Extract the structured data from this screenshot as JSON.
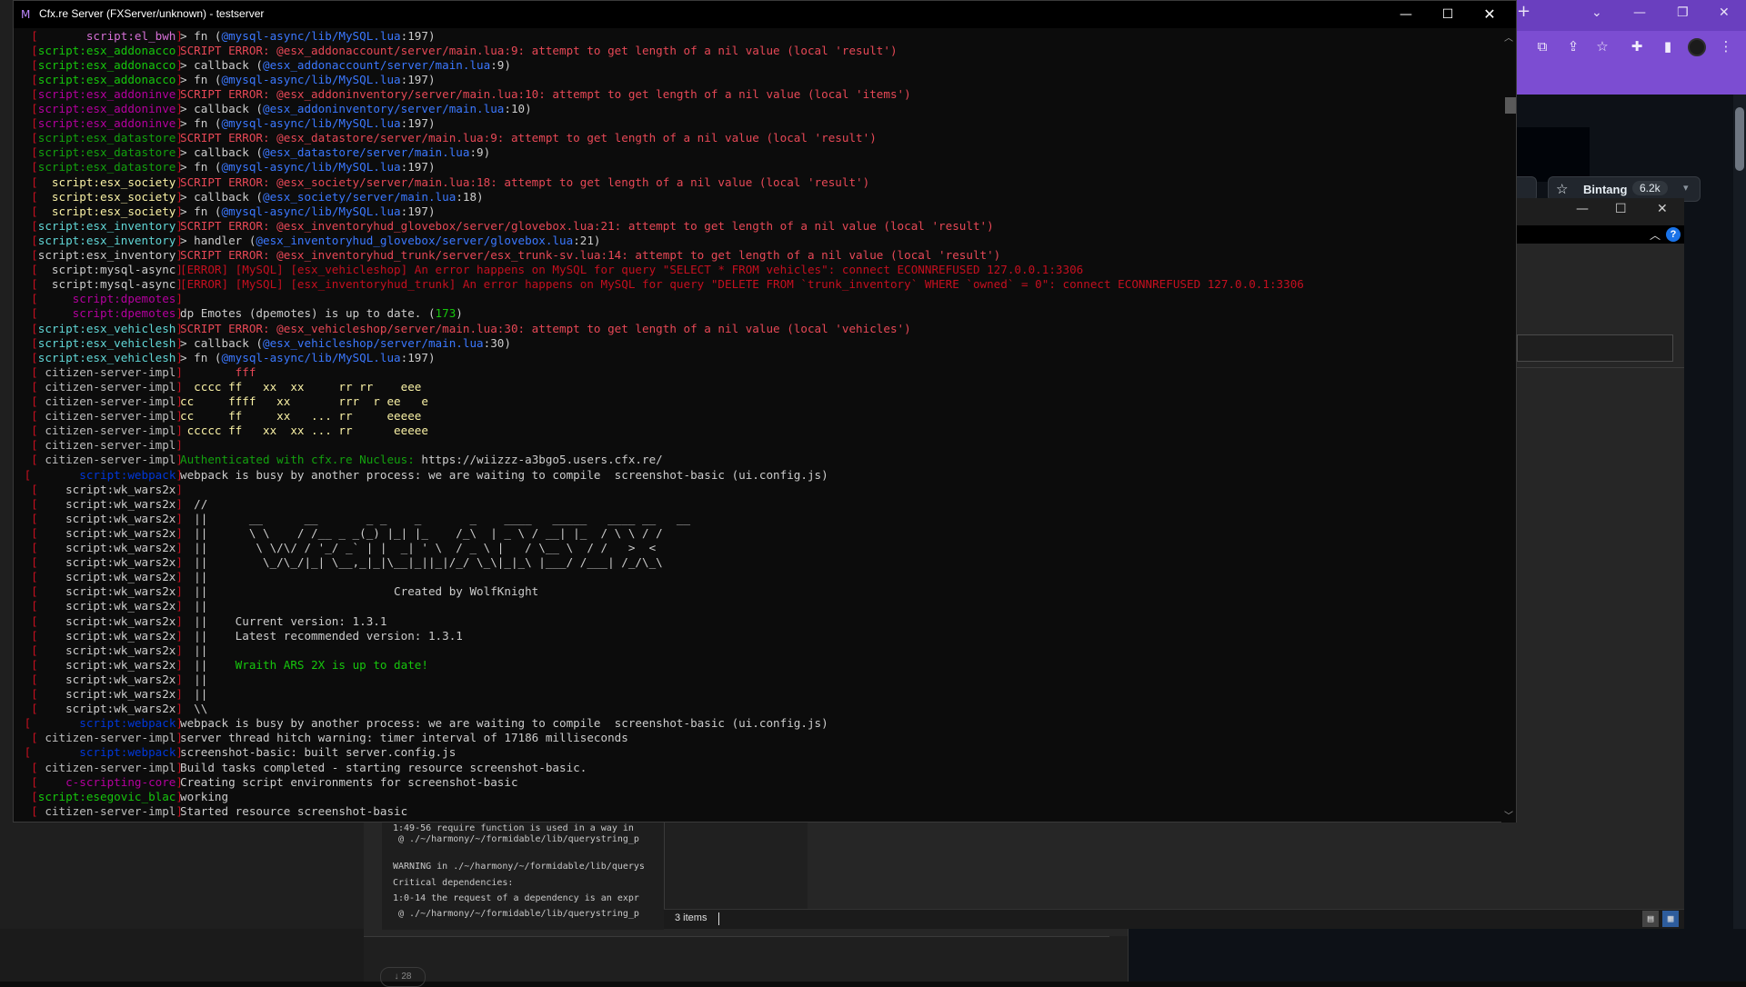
{
  "window": {
    "title": "Cfx.re Server (FXServer/unknown) - testserver",
    "app_icon": "fivem-logo-icon",
    "minimize": "—",
    "maximize": "☐",
    "close": "✕"
  },
  "colors": {
    "bracket_red": "#c50f1f",
    "white": "#cccccc",
    "red": "#e74856",
    "blue": "#3b78ff",
    "green": "#16c60c",
    "yellow": "#f9f1a5",
    "cyan": "#61d6d6",
    "magenta": "#b4009e",
    "bright_magenta": "#d670d6",
    "gray": "#bdbdbd",
    "dark_blue": "#0037da",
    "bright_green": "#13a10e"
  },
  "console_lines": [
    {
      "tag": "[       script:el_bwh]",
      "tag_color": "#d670d6",
      "segments": [
        {
          "t": "> fn (",
          "c": "#cccccc"
        },
        {
          "t": "@mysql-async/lib/MySQL.lua",
          "c": "#3b78ff"
        },
        {
          "t": ":197)",
          "c": "#cccccc"
        }
      ]
    },
    {
      "tag": "[script:esx_addonacco]",
      "tag_color": "#16c60c",
      "segments": [
        {
          "t": "SCRIPT ERROR: @esx_addonaccount/server/main.lua:9: attempt to get length of a nil value (local 'result')",
          "c": "#e74856"
        }
      ]
    },
    {
      "tag": "[script:esx_addonacco]",
      "tag_color": "#16c60c",
      "segments": [
        {
          "t": "> callback (",
          "c": "#cccccc"
        },
        {
          "t": "@esx_addonaccount/server/main.lua",
          "c": "#3b78ff"
        },
        {
          "t": ":9)",
          "c": "#cccccc"
        }
      ]
    },
    {
      "tag": "[script:esx_addonacco]",
      "tag_color": "#16c60c",
      "segments": [
        {
          "t": "> fn (",
          "c": "#cccccc"
        },
        {
          "t": "@mysql-async/lib/MySQL.lua",
          "c": "#3b78ff"
        },
        {
          "t": ":197)",
          "c": "#cccccc"
        }
      ]
    },
    {
      "tag": "[script:esx_addoninve]",
      "tag_color": "#b4009e",
      "segments": [
        {
          "t": "SCRIPT ERROR: @esx_addoninventory/server/main.lua:10: attempt to get length of a nil value (local 'items')",
          "c": "#e74856"
        }
      ]
    },
    {
      "tag": "[script:esx_addoninve]",
      "tag_color": "#b4009e",
      "segments": [
        {
          "t": "> callback (",
          "c": "#cccccc"
        },
        {
          "t": "@esx_addoninventory/server/main.lua",
          "c": "#3b78ff"
        },
        {
          "t": ":10)",
          "c": "#cccccc"
        }
      ]
    },
    {
      "tag": "[script:esx_addoninve]",
      "tag_color": "#b4009e",
      "segments": [
        {
          "t": "> fn (",
          "c": "#cccccc"
        },
        {
          "t": "@mysql-async/lib/MySQL.lua",
          "c": "#3b78ff"
        },
        {
          "t": ":197)",
          "c": "#cccccc"
        }
      ]
    },
    {
      "tag": "[script:esx_datastore]",
      "tag_color": "#13a10e",
      "segments": [
        {
          "t": "SCRIPT ERROR: @esx_datastore/server/main.lua:9: attempt to get length of a nil value (local 'result')",
          "c": "#e74856"
        }
      ]
    },
    {
      "tag": "[script:esx_datastore]",
      "tag_color": "#13a10e",
      "segments": [
        {
          "t": "> callback (",
          "c": "#cccccc"
        },
        {
          "t": "@esx_datastore/server/main.lua",
          "c": "#3b78ff"
        },
        {
          "t": ":9)",
          "c": "#cccccc"
        }
      ]
    },
    {
      "tag": "[script:esx_datastore]",
      "tag_color": "#13a10e",
      "segments": [
        {
          "t": "> fn (",
          "c": "#cccccc"
        },
        {
          "t": "@mysql-async/lib/MySQL.lua",
          "c": "#3b78ff"
        },
        {
          "t": ":197)",
          "c": "#cccccc"
        }
      ]
    },
    {
      "tag": "[  script:esx_society]",
      "tag_color": "#f9f1a5",
      "segments": [
        {
          "t": "SCRIPT ERROR: @esx_society/server/main.lua:18: attempt to get length of a nil value (local 'result')",
          "c": "#e74856"
        }
      ]
    },
    {
      "tag": "[  script:esx_society]",
      "tag_color": "#f9f1a5",
      "segments": [
        {
          "t": "> callback (",
          "c": "#cccccc"
        },
        {
          "t": "@esx_society/server/main.lua",
          "c": "#3b78ff"
        },
        {
          "t": ":18)",
          "c": "#cccccc"
        }
      ]
    },
    {
      "tag": "[  script:esx_society]",
      "tag_color": "#f9f1a5",
      "segments": [
        {
          "t": "> fn (",
          "c": "#cccccc"
        },
        {
          "t": "@mysql-async/lib/MySQL.lua",
          "c": "#3b78ff"
        },
        {
          "t": ":197)",
          "c": "#cccccc"
        }
      ]
    },
    {
      "tag": "[script:esx_inventory]",
      "tag_color": "#61d6d6",
      "segments": [
        {
          "t": "SCRIPT ERROR: @esx_inventoryhud_glovebox/server/glovebox.lua:21: attempt to get length of a nil value (local 'result')",
          "c": "#e74856"
        }
      ]
    },
    {
      "tag": "[script:esx_inventory]",
      "tag_color": "#61d6d6",
      "segments": [
        {
          "t": "> handler (",
          "c": "#cccccc"
        },
        {
          "t": "@esx_inventoryhud_glovebox/server/glovebox.lua",
          "c": "#3b78ff"
        },
        {
          "t": ":21)",
          "c": "#cccccc"
        }
      ]
    },
    {
      "tag": "[script:esx_inventory]",
      "tag_color": "#cccccc",
      "segments": [
        {
          "t": "SCRIPT ERROR: @esx_inventoryhud_trunk/server/esx_trunk-sv.lua:14: attempt to get length of a nil value (local 'result')",
          "c": "#e74856"
        }
      ]
    },
    {
      "tag": "[  script:mysql-async]",
      "tag_color": "#cccccc",
      "segments": [
        {
          "t": "[ERROR] [MySQL] [esx_vehicleshop] An error happens on MySQL for query \"SELECT * FROM vehicles\": connect ECONNREFUSED 127.0.0.1:3306",
          "c": "#c50f1f"
        }
      ]
    },
    {
      "tag": "[  script:mysql-async]",
      "tag_color": "#cccccc",
      "segments": [
        {
          "t": "[ERROR] [MySQL] [esx_inventoryhud_trunk] An error happens on MySQL for query \"DELETE FROM `trunk_inventory` WHERE `owned` = 0\": connect ECONNREFUSED 127.0.0.1:3306",
          "c": "#c50f1f"
        }
      ]
    },
    {
      "tag": "[     script:dpemotes]",
      "tag_color": "#b4009e",
      "segments": []
    },
    {
      "tag": "[     script:dpemotes]",
      "tag_color": "#b4009e",
      "segments": [
        {
          "t": "dp Emotes (dpemotes) is up to date. (",
          "c": "#cccccc"
        },
        {
          "t": "173",
          "c": "#16c60c"
        },
        {
          "t": ")",
          "c": "#cccccc"
        }
      ]
    },
    {
      "tag": "[script:esx_vehiclesh]",
      "tag_color": "#61d6d6",
      "segments": [
        {
          "t": "SCRIPT ERROR: @esx_vehicleshop/server/main.lua:30: attempt to get length of a nil value (local 'vehicles')",
          "c": "#e74856"
        }
      ]
    },
    {
      "tag": "[script:esx_vehiclesh]",
      "tag_color": "#61d6d6",
      "segments": [
        {
          "t": "> callback (",
          "c": "#cccccc"
        },
        {
          "t": "@esx_vehicleshop/server/main.lua",
          "c": "#3b78ff"
        },
        {
          "t": ":30)",
          "c": "#cccccc"
        }
      ]
    },
    {
      "tag": "[script:esx_vehiclesh]",
      "tag_color": "#61d6d6",
      "segments": [
        {
          "t": "> fn (",
          "c": "#cccccc"
        },
        {
          "t": "@mysql-async/lib/MySQL.lua",
          "c": "#3b78ff"
        },
        {
          "t": ":197)",
          "c": "#cccccc"
        }
      ]
    },
    {
      "tag": "[ citizen-server-impl]",
      "tag_color": "#bdbdbd",
      "segments": [
        {
          "t": "        fff",
          "c": "#e74856"
        }
      ]
    },
    {
      "tag": "[ citizen-server-impl]",
      "tag_color": "#bdbdbd",
      "segments": [
        {
          "t": "  cccc ff   xx  xx     rr rr    eee",
          "c": "#f9f1a5"
        }
      ]
    },
    {
      "tag": "[ citizen-server-impl]",
      "tag_color": "#bdbdbd",
      "segments": [
        {
          "t": "cc     ffff   xx       rrr  r ee   e",
          "c": "#f9f1a5"
        }
      ]
    },
    {
      "tag": "[ citizen-server-impl]",
      "tag_color": "#bdbdbd",
      "segments": [
        {
          "t": "cc     ff     xx   ... rr     eeeee",
          "c": "#f9f1a5"
        }
      ]
    },
    {
      "tag": "[ citizen-server-impl]",
      "tag_color": "#bdbdbd",
      "segments": [
        {
          "t": " ccccc ff   xx  xx ... rr      eeeee",
          "c": "#f9f1a5"
        }
      ]
    },
    {
      "tag": "[ citizen-server-impl]",
      "tag_color": "#bdbdbd",
      "segments": []
    },
    {
      "tag": "[ citizen-server-impl]",
      "tag_color": "#bdbdbd",
      "segments": [
        {
          "t": "Authenticated with cfx.re Nucleus: ",
          "c": "#13a10e"
        },
        {
          "t": "https://wiizzz-a3bgo5.users.cfx.re/",
          "c": "#cccccc"
        }
      ]
    },
    {
      "tag": "[       script:webpack]",
      "tag_color": "#0037da",
      "segments": [
        {
          "t": "webpack is busy by another process: we are waiting to compile  screenshot-basic (ui.config.js)",
          "c": "#cccccc"
        }
      ]
    },
    {
      "tag": "[    script:wk_wars2x]",
      "tag_color": "#cccccc",
      "segments": []
    },
    {
      "tag": "[    script:wk_wars2x]",
      "tag_color": "#cccccc",
      "segments": [
        {
          "t": "  //",
          "c": "#cccccc"
        }
      ]
    },
    {
      "tag": "[    script:wk_wars2x]",
      "tag_color": "#cccccc",
      "segments": [
        {
          "t": "  ||      __      __       _ _    _       _    ____   _____   ____ __   __",
          "c": "#cccccc"
        }
      ]
    },
    {
      "tag": "[    script:wk_wars2x]",
      "tag_color": "#cccccc",
      "segments": [
        {
          "t": "  ||      \\ \\    / /__ _ _(_) |_| |_    /_\\  | _ \\ / __| |_  / \\ \\ / /",
          "c": "#cccccc"
        }
      ]
    },
    {
      "tag": "[    script:wk_wars2x]",
      "tag_color": "#cccccc",
      "segments": [
        {
          "t": "  ||       \\ \\/\\/ / '_/ _` | |  _| ' \\  / _ \\ |   / \\__ \\  / /   >  <",
          "c": "#cccccc"
        }
      ]
    },
    {
      "tag": "[    script:wk_wars2x]",
      "tag_color": "#cccccc",
      "segments": [
        {
          "t": "  ||        \\_/\\_/|_| \\__,_|_|\\__|_||_|/_/ \\_\\|_|_\\ |___/ /___| /_/\\_\\",
          "c": "#cccccc"
        }
      ]
    },
    {
      "tag": "[    script:wk_wars2x]",
      "tag_color": "#cccccc",
      "segments": [
        {
          "t": "  ||",
          "c": "#cccccc"
        }
      ]
    },
    {
      "tag": "[    script:wk_wars2x]",
      "tag_color": "#cccccc",
      "segments": [
        {
          "t": "  ||                           Created by WolfKnight",
          "c": "#cccccc"
        }
      ]
    },
    {
      "tag": "[    script:wk_wars2x]",
      "tag_color": "#cccccc",
      "segments": [
        {
          "t": "  ||",
          "c": "#cccccc"
        }
      ]
    },
    {
      "tag": "[    script:wk_wars2x]",
      "tag_color": "#cccccc",
      "segments": [
        {
          "t": "  ||    Current version: 1.3.1",
          "c": "#cccccc"
        }
      ]
    },
    {
      "tag": "[    script:wk_wars2x]",
      "tag_color": "#cccccc",
      "segments": [
        {
          "t": "  ||    Latest recommended version: 1.3.1",
          "c": "#cccccc"
        }
      ]
    },
    {
      "tag": "[    script:wk_wars2x]",
      "tag_color": "#cccccc",
      "segments": [
        {
          "t": "  ||",
          "c": "#cccccc"
        }
      ]
    },
    {
      "tag": "[    script:wk_wars2x]",
      "tag_color": "#cccccc",
      "segments": [
        {
          "t": "  ||    ",
          "c": "#cccccc"
        },
        {
          "t": "Wraith ARS 2X is up to date!",
          "c": "#16c60c"
        }
      ]
    },
    {
      "tag": "[    script:wk_wars2x]",
      "tag_color": "#cccccc",
      "segments": [
        {
          "t": "  ||",
          "c": "#cccccc"
        }
      ]
    },
    {
      "tag": "[    script:wk_wars2x]",
      "tag_color": "#cccccc",
      "segments": [
        {
          "t": "  ||",
          "c": "#cccccc"
        }
      ]
    },
    {
      "tag": "[    script:wk_wars2x]",
      "tag_color": "#cccccc",
      "segments": [
        {
          "t": "  \\\\",
          "c": "#cccccc"
        }
      ]
    },
    {
      "tag": "[       script:webpack]",
      "tag_color": "#0037da",
      "segments": [
        {
          "t": "webpack is busy by another process: we are waiting to compile  screenshot-basic (ui.config.js)",
          "c": "#cccccc"
        }
      ]
    },
    {
      "tag": "[ citizen-server-impl]",
      "tag_color": "#bdbdbd",
      "segments": [
        {
          "t": "server thread hitch warning: timer interval of 17186 milliseconds",
          "c": "#cccccc"
        }
      ]
    },
    {
      "tag": "[       script:webpack]",
      "tag_color": "#0037da",
      "segments": [
        {
          "t": "screenshot-basic: built server.config.js",
          "c": "#cccccc"
        }
      ]
    },
    {
      "tag": "[ citizen-server-impl]",
      "tag_color": "#bdbdbd",
      "segments": [
        {
          "t": "Build tasks completed - starting resource screenshot-basic.",
          "c": "#cccccc"
        }
      ]
    },
    {
      "tag": "[    c-scripting-core]",
      "tag_color": "#b4009e",
      "segments": [
        {
          "t": "Creating script environments for screenshot-basic",
          "c": "#cccccc"
        }
      ]
    },
    {
      "tag": "[script:esegovic_blac]",
      "tag_color": "#16c60c",
      "segments": [
        {
          "t": "working",
          "c": "#cccccc"
        }
      ]
    },
    {
      "tag": "[ citizen-server-impl]",
      "tag_color": "#bdbdbd",
      "segments": [
        {
          "t": "Started resource screenshot-basic",
          "c": "#cccccc"
        }
      ]
    }
  ],
  "browser": {
    "new_tab": "+",
    "dropdown": "⌄",
    "minimize": "—",
    "restore": "❐",
    "close": "✕",
    "icons": [
      "translate-icon",
      "share-icon",
      "star-outline-icon",
      "extensions-icon",
      "sidebar-icon",
      "avatar",
      "menu-icon"
    ],
    "icon_glyphs": [
      "⧉",
      "⇪",
      "☆",
      "✚",
      "▮",
      "",
      "⋮"
    ],
    "star_button": {
      "label": "Bintang",
      "count": "6.2k",
      "icon": "☆",
      "dropdown": "▾"
    }
  },
  "second_window": {
    "minimize": "—",
    "maximize": "☐",
    "close": "✕",
    "chevron": "︿",
    "help": "?"
  },
  "output_panel": {
    "lines": [
      "1:49-56 require function is used in a way in",
      " @ ./~/harmony/~/formidable/lib/querystring_p",
      "",
      "WARNING in ./~/harmony/~/formidable/lib/querys",
      "Critical dependencies:",
      "1:0-14 the request of a dependency is an expr",
      " @ ./~/harmony/~/formidable/lib/querystring_p"
    ]
  },
  "status_bar": {
    "items": "3 items"
  },
  "bottom_pill": "↓ 28"
}
